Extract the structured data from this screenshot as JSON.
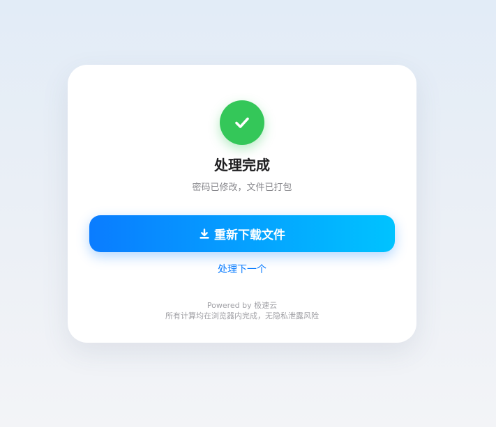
{
  "result": {
    "status_icon": "checkmark-icon",
    "title": "处理完成",
    "subtitle": "密码已修改，文件已打包"
  },
  "actions": {
    "download_icon": "download-icon",
    "download_label": "重新下载文件",
    "next_label": "处理下一个"
  },
  "footer": {
    "powered_by": "Powered by 极速云",
    "privacy_note": "所有计算均在浏览器内完成，无隐私泄露风险"
  },
  "colors": {
    "success": "#34c759",
    "accent_start": "#0a7cff",
    "accent_end": "#00c3ff",
    "link": "#0a7cff"
  }
}
